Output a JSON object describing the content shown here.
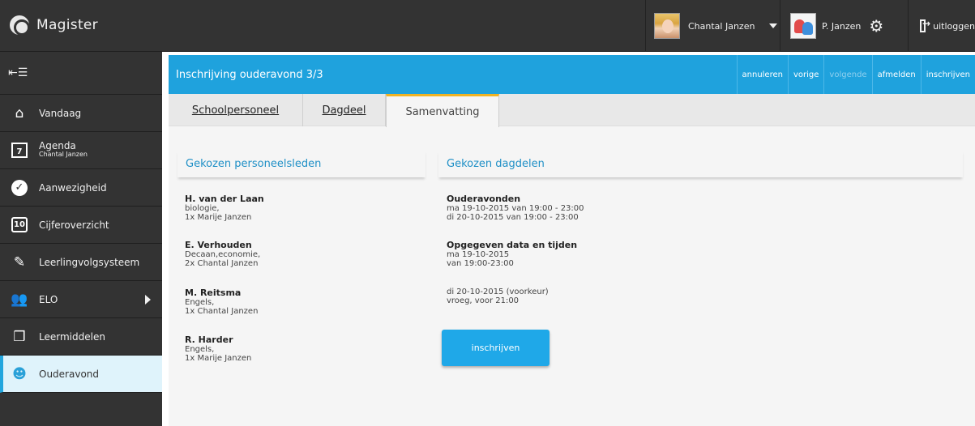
{
  "app": {
    "title": "Magister"
  },
  "topbar": {
    "user_name": "Chantal Janzen",
    "parent_name": "P. Janzen",
    "logout_label": "uitloggen"
  },
  "sidebar": {
    "items": [
      {
        "label": "Vandaag",
        "icon": "home-icon"
      },
      {
        "label": "Agenda",
        "sub": "Chantal Janzen",
        "icon": "calendar-icon",
        "icon_text": "7"
      },
      {
        "label": "Aanwezigheid",
        "icon": "check-icon"
      },
      {
        "label": "Cijferoverzicht",
        "icon": "grades-icon",
        "icon_text": "10"
      },
      {
        "label": "Leerlingvolgsysteem",
        "icon": "notebook-icon"
      },
      {
        "label": "ELO",
        "icon": "group-icon"
      },
      {
        "label": "Leermiddelen",
        "icon": "books-icon"
      },
      {
        "label": "Ouderavond",
        "icon": "parent-chat-icon",
        "active": true
      }
    ]
  },
  "header": {
    "title": "Inschrijving ouderavond 3/3",
    "actions": [
      "annuleren",
      "vorige",
      "volgende",
      "afmelden",
      "inschrijven"
    ]
  },
  "tabs": [
    "Schoolpersoneel",
    "Dagdeel",
    "Samenvatting"
  ],
  "staff": {
    "heading": "Gekozen personeelsleden",
    "items": [
      {
        "name": "H. van der Laan",
        "line1": "biologie,",
        "line2": "1x Marije Janzen"
      },
      {
        "name": "E. Verhouden",
        "line1": "Decaan,economie,",
        "line2": "2x Chantal Janzen"
      },
      {
        "name": "M. Reitsma",
        "line1": "Engels,",
        "line2": "1x Chantal Janzen"
      },
      {
        "name": "R. Harder",
        "line1": "Engels,",
        "line2": "1x Marije Janzen"
      }
    ]
  },
  "dayparts": {
    "heading": "Gekozen dagdelen",
    "evenings_title": "Ouderavonden",
    "evenings": [
      "ma 19-10-2015 van 19:00 - 23:00",
      "di 20-10-2015 van 19:00 - 23:00"
    ],
    "given_title": "Opgegeven data en tijden",
    "given1": [
      "ma 19-10-2015",
      "van 19:00-23:00"
    ],
    "given2": [
      "di 20-10-2015 (voorkeur)",
      "vroeg, voor 21:00"
    ],
    "button": "inschrijven"
  }
}
